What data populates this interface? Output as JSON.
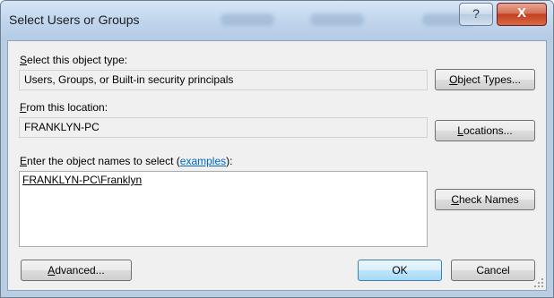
{
  "window": {
    "title": "Select Users or Groups",
    "help_label": "?",
    "close_label": "X"
  },
  "object_type": {
    "label": "Select this object type:",
    "value": "Users, Groups, or Built-in security principals",
    "button": "Object Types..."
  },
  "location": {
    "label": "From this location:",
    "value": "FRANKLYN-PC",
    "button": "Locations..."
  },
  "names": {
    "label_prefix": "Enter the object names to select (",
    "label_link": "examples",
    "label_suffix": "):",
    "value": "FRANKLYN-PC\\Franklyn",
    "check_button": "Check Names"
  },
  "footer": {
    "advanced_button": "Advanced...",
    "ok_button": "OK",
    "cancel_button": "Cancel"
  }
}
